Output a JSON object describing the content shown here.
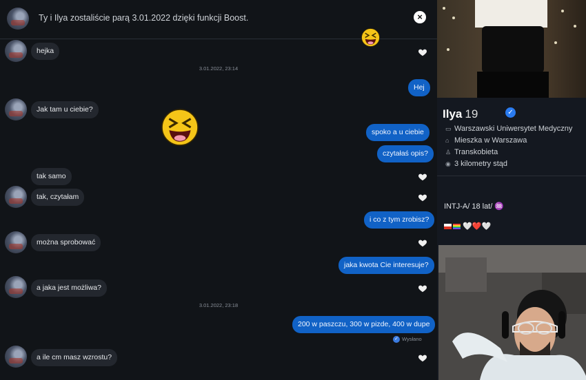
{
  "header": {
    "match_text": "Ty i Ilya zostaliście parą 3.01.2022 dzięki funkcji Boost.",
    "close_label": "×"
  },
  "messages": [
    {
      "dir": "in",
      "text": "hejka"
    },
    {
      "dir": "stamp",
      "text": "3.01.2022, 23:14"
    },
    {
      "dir": "out",
      "text": "Hej"
    },
    {
      "dir": "in",
      "text": "Jak tam u ciebie?"
    },
    {
      "dir": "out",
      "text": "spoko a u ciebie"
    },
    {
      "dir": "out",
      "text": "czytałaś opis?"
    },
    {
      "dir": "in",
      "text": "tak samo"
    },
    {
      "dir": "in",
      "text": "tak, czytałam"
    },
    {
      "dir": "out",
      "text": "i co z tym zrobisz?"
    },
    {
      "dir": "in",
      "text": "można sprobować"
    },
    {
      "dir": "out",
      "text": "jaka kwota Cie interesuje?"
    },
    {
      "dir": "in",
      "text": "a jaka jest możliwa?"
    },
    {
      "dir": "stamp",
      "text": "3.01.2022, 23:18"
    },
    {
      "dir": "out",
      "text": "200 w paszczu, 300 w pizde, 400 w dupe"
    },
    {
      "dir": "status",
      "text": "Wysłano"
    },
    {
      "dir": "in",
      "text": "a ile cm masz wzrostu?"
    }
  ],
  "profile": {
    "name": "Ilya",
    "age": "19",
    "school": "Warszawski Uniwersytet Medyczny",
    "city": "Mieszka w Warszawa",
    "gender": "Transkobieta",
    "distance": "3 kilometry stąd",
    "bio_line": "INTJ-A/ 18 lat/",
    "bio_zodiac": "♒",
    "bio_hearts": "🤍❤️🤍",
    "icons": [
      "school-icon",
      "home-icon",
      "person-icon",
      "location-icon"
    ]
  },
  "colors": {
    "outgoing": "#1162c6",
    "incoming": "#23272e",
    "background": "#111418",
    "verified": "#2a7bf0"
  }
}
